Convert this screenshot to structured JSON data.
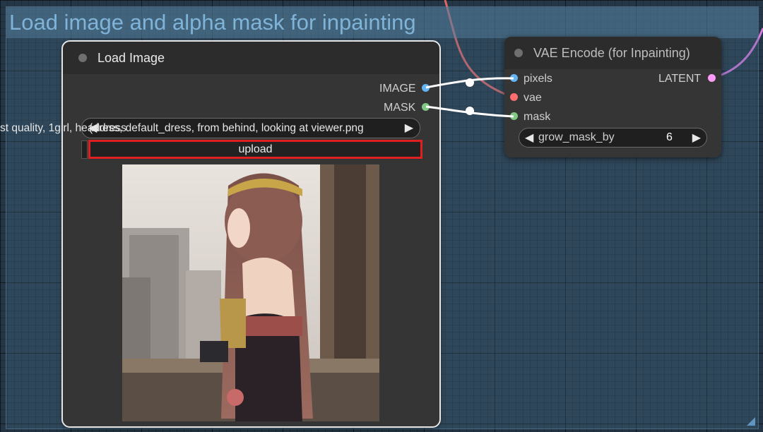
{
  "group": {
    "title": "Load image and alpha mask for inpainting"
  },
  "load_image_node": {
    "title": "Load Image",
    "outputs": [
      "IMAGE",
      "MASK"
    ],
    "image_overflow_text": "st quality, 1girl,  headdress",
    "image_value": "(dress, default_dress, from behind, looking at viewer.png",
    "upload_label": "upload",
    "preview": "anime-girl-at-window-image"
  },
  "vae_node": {
    "title": "VAE Encode (for Inpainting)",
    "inputs": [
      "pixels",
      "vae",
      "mask"
    ],
    "output": "LATENT",
    "grow_mask": {
      "label": "grow_mask_by",
      "value": "6"
    }
  },
  "colors": {
    "image_slot": "#64b5f6",
    "mask_slot": "#81c784",
    "vae_slot": "#ff6e6e",
    "latent_slot": "#ff9cf9",
    "highlight": "#e02020"
  }
}
